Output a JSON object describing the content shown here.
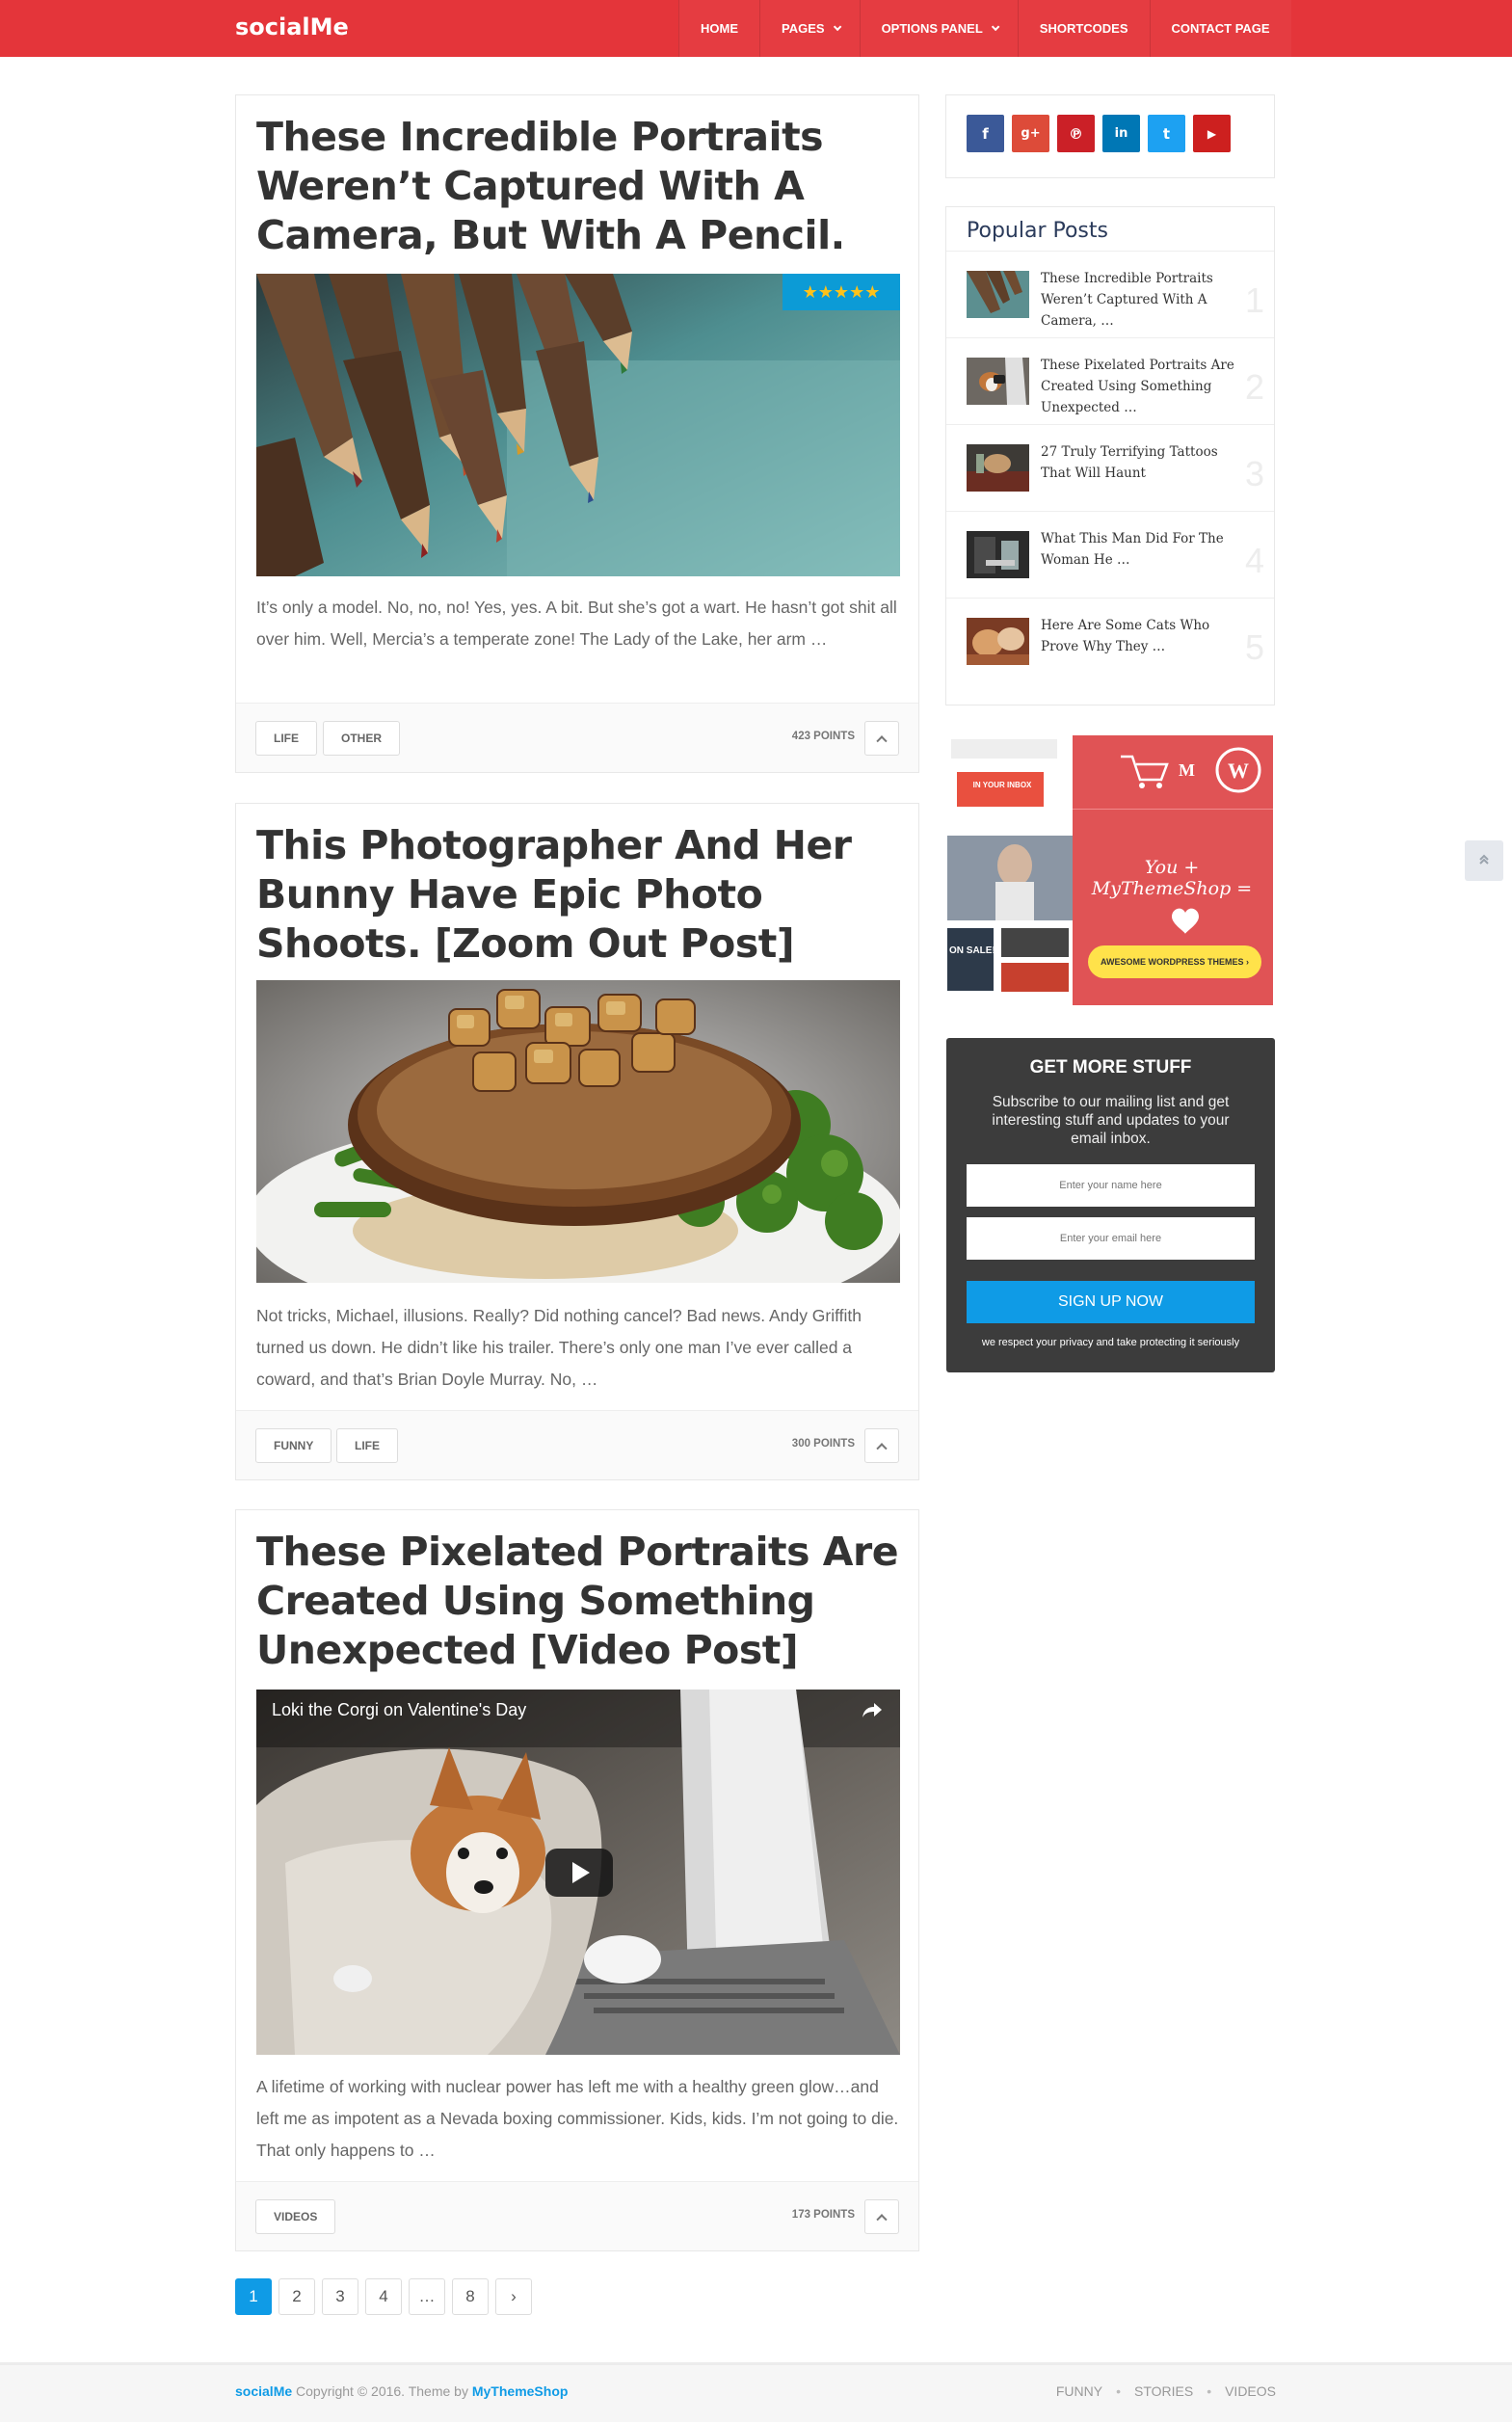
{
  "header": {
    "logo": "socialMe",
    "nav": [
      {
        "label": "HOME",
        "dropdown": false
      },
      {
        "label": "PAGES",
        "dropdown": true
      },
      {
        "label": "OPTIONS PANEL",
        "dropdown": true
      },
      {
        "label": "SHORTCODES",
        "dropdown": false
      },
      {
        "label": "CONTACT PAGE",
        "dropdown": false
      }
    ]
  },
  "posts": [
    {
      "title": "These Incredible Portraits Weren’t Captured With A Camera, But With A Pencil.",
      "media": "colored-pencils-image",
      "rating": "★★★★★",
      "excerpt": "It’s only a model. No, no, no! Yes, yes. A bit. But she’s got a wart. He hasn’t got shit all over him. Well, Mercia’s a temperate zone! The Lady of the Lake, her arm …",
      "tags": [
        "LIFE",
        "OTHER"
      ],
      "points": "423 POINTS"
    },
    {
      "title": "This Photographer And Her Bunny Have Epic Photo Shoots. [Zoom Out Post]",
      "media": "grilled-steak-image",
      "excerpt": "Not tricks, Michael, illusions. Really? Did nothing cancel? Bad news. Andy Griffith turned us down. He didn’t like his trailer. There’s only one man I’ve ever called a coward, and that’s Brian Doyle Murray. No, …",
      "tags": [
        "FUNNY",
        "LIFE"
      ],
      "points": "300 POINTS"
    },
    {
      "title": "These Pixelated Portraits Are Created Using Something Unexpected [Video Post]",
      "media": "corgi-video",
      "video_title": "Loki the Corgi on Valentine's Day",
      "excerpt": "A lifetime of working with nuclear power has left me with a healthy green glow…and left me as impotent as a Nevada boxing commissioner. Kids, kids. I’m not going to die. That only happens to …",
      "tags": [
        "VIDEOS"
      ],
      "points": "173 POINTS"
    }
  ],
  "pagination": [
    "1",
    "2",
    "3",
    "4",
    "…",
    "8",
    "›"
  ],
  "pagination_active": "1",
  "sidebar": {
    "social": [
      {
        "name": "facebook-icon",
        "glyph": "f",
        "color": "#3b5998"
      },
      {
        "name": "google-plus-icon",
        "glyph": "g+",
        "color": "#dd4b39"
      },
      {
        "name": "pinterest-icon",
        "glyph": "℗",
        "color": "#cb2027"
      },
      {
        "name": "linkedin-icon",
        "glyph": "in",
        "color": "#0077b5"
      },
      {
        "name": "twitter-icon",
        "glyph": "t",
        "color": "#1da1f2"
      },
      {
        "name": "youtube-icon",
        "glyph": "▶",
        "color": "#cd201f"
      }
    ],
    "popular_title": "Popular Posts",
    "popular": [
      {
        "title": "These Incredible Portraits Weren’t Captured With A Camera, …",
        "num": "1"
      },
      {
        "title": "These Pixelated Portraits Are Created Using Something Unexpected …",
        "num": "2"
      },
      {
        "title": "27 Truly Terrifying Tattoos That Will Haunt",
        "num": "3"
      },
      {
        "title": "What This Man Did For The Woman He …",
        "num": "4"
      },
      {
        "title": "Here Are Some Cats Who Prove Why They …",
        "num": "5"
      }
    ],
    "ad": {
      "tagline": "You + MyThemeShop =",
      "button": "AWESOME WORDPRESS THEMES ›",
      "sale": "ON SALE!",
      "inbox": "IN YOUR INBOX"
    },
    "subscribe": {
      "title": "GET MORE STUFF",
      "description": "Subscribe to our mailing list and get interesting stuff and updates to your email inbox.",
      "name_placeholder": "Enter your name here",
      "email_placeholder": "Enter your email here",
      "button": "SIGN UP NOW",
      "note": "we respect your privacy and take protecting it seriously"
    }
  },
  "footer": {
    "brand": "socialMe",
    "copyright": " Copyright © 2016. Theme by ",
    "theme_link": "MyThemeShop",
    "links": [
      "FUNNY",
      "STORIES",
      "VIDEOS"
    ]
  },
  "colors": {
    "header": "#e4353a",
    "accent": "#0f9be6",
    "subscribe_bg": "#3c3c3c"
  }
}
